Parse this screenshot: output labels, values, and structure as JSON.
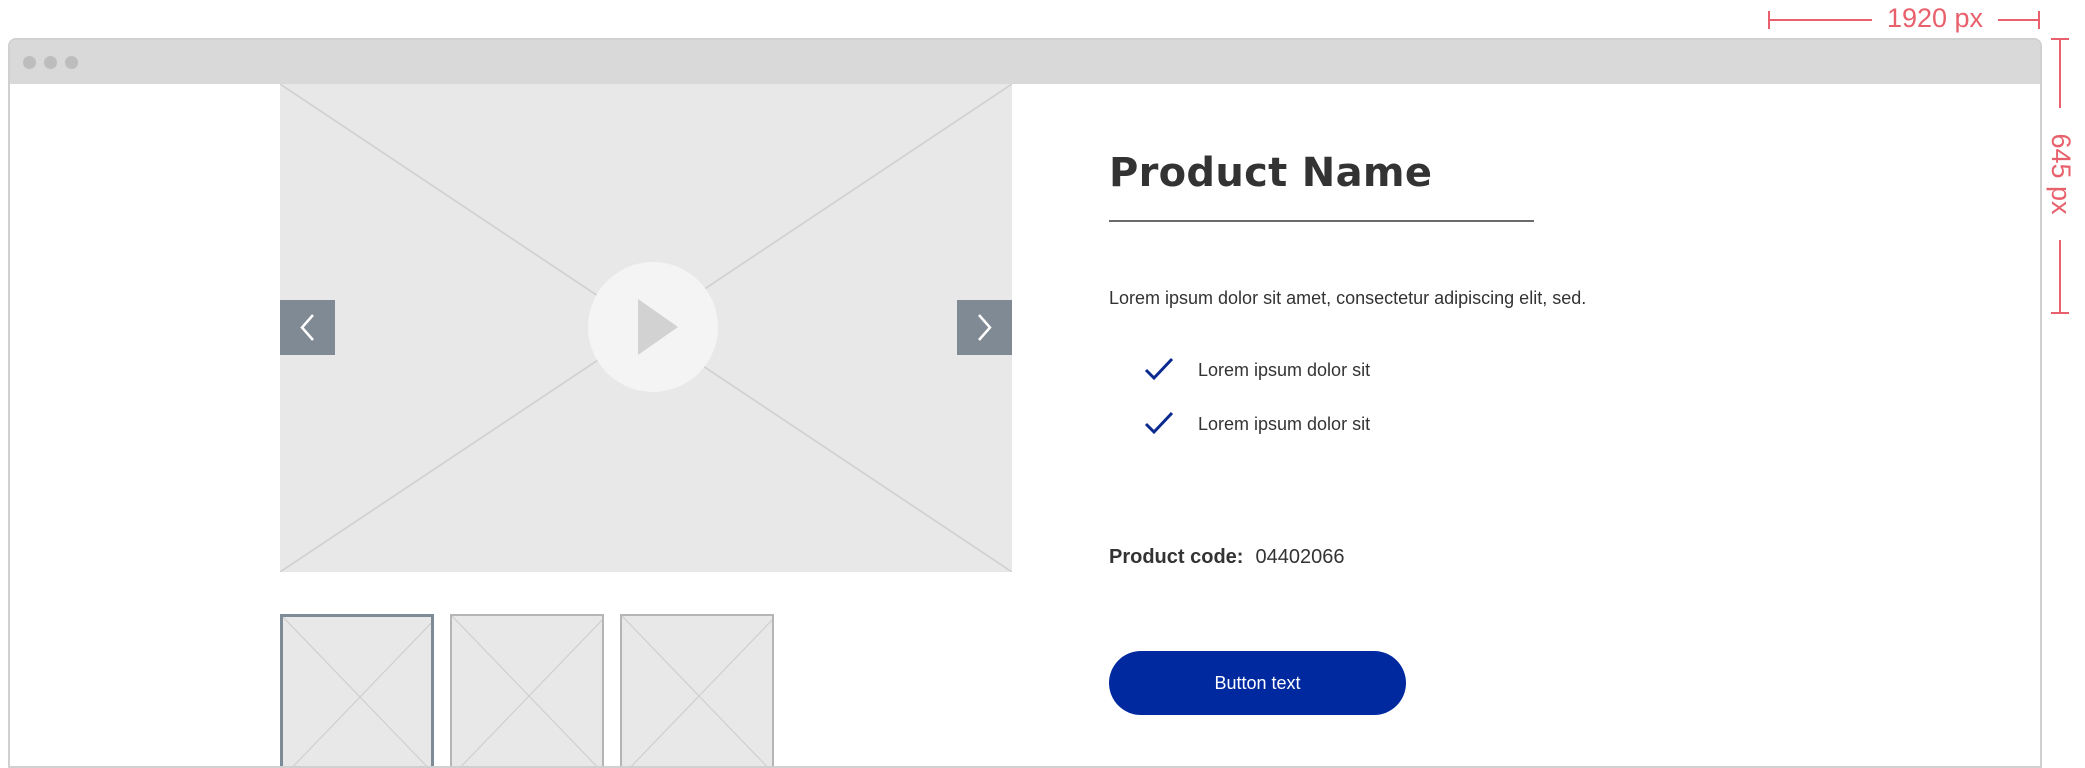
{
  "annotations": {
    "width_label": "1920 px",
    "height_label": "645 px",
    "color": "#e8606c"
  },
  "window": {
    "titlebar_dots": 3
  },
  "gallery": {
    "main_image": "image-placeholder",
    "play_icon": "play-icon",
    "prev_icon": "chevron-left-icon",
    "next_icon": "chevron-right-icon",
    "thumbnails": [
      "image-placeholder",
      "image-placeholder",
      "image-placeholder"
    ],
    "active_thumbnail": 1
  },
  "product": {
    "name": "Product Name",
    "description": "Lorem ipsum dolor sit amet, consectetur adipiscing elit, sed.",
    "features": [
      "Lorem ipsum dolor sit",
      "Lorem ipsum dolor sit"
    ],
    "code_label": "Product code:",
    "code_value": "04402066",
    "button_label": "Button text"
  },
  "colors": {
    "accent": "#0029a0",
    "check": "#0a2a8f",
    "arrow_bg": "#808a94",
    "placeholder_bg": "#e8e8e8"
  }
}
